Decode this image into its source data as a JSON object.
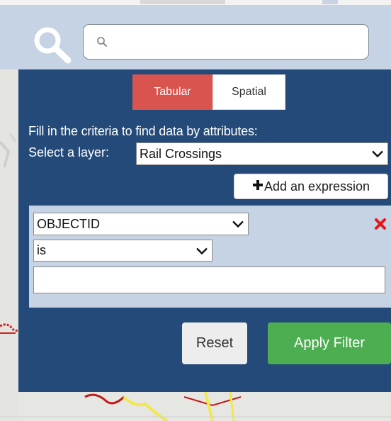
{
  "search": {
    "placeholder": "",
    "value": ""
  },
  "filter_panel": {
    "tabs": [
      {
        "label": "Tabular",
        "active": true
      },
      {
        "label": "Spatial",
        "active": false
      }
    ],
    "instructions": "Fill in the criteria to find data by attributes:",
    "layer_label": "Select a layer:",
    "layer_selected": "Rail Crossings",
    "add_expression_label": "Add an expression",
    "expression": {
      "field_selected": "OBJECTID",
      "operator_selected": "is",
      "value": ""
    },
    "reset_label": "Reset",
    "apply_label": "Apply Filter"
  },
  "colors": {
    "panel_bg": "#234a78",
    "search_bar_bg": "#c5d3e5",
    "tab_active": "#d9534f",
    "apply_button": "#4cae50",
    "remove_icon": "#e8141b"
  }
}
